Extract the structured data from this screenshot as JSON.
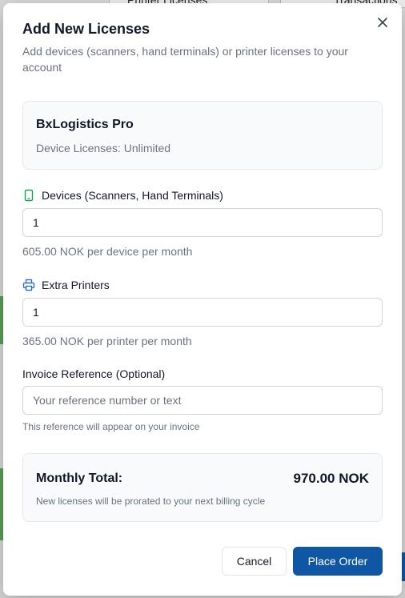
{
  "background": {
    "tab_left_label": "Printer Licenses",
    "tab_right_label": "Transactions"
  },
  "dialog": {
    "title": "Add New Licenses",
    "subtitle": "Add devices (scanners, hand terminals) or printer licenses to your account",
    "close_icon": "close-icon"
  },
  "plan": {
    "name": "BxLogistics Pro",
    "detail": "Device Licenses: Unlimited"
  },
  "devices": {
    "icon": "device-icon",
    "label": "Devices (Scanners, Hand Terminals)",
    "value": "1",
    "price_note": "605.00 NOK per device per month"
  },
  "printers": {
    "icon": "printer-icon",
    "label": "Extra Printers",
    "value": "1",
    "price_note": "365.00 NOK per printer per month"
  },
  "invoice_reference": {
    "label": "Invoice Reference (Optional)",
    "value": "",
    "placeholder": "Your reference number or text",
    "note": "This reference will appear on your invoice"
  },
  "total": {
    "label": "Monthly Total:",
    "value": "970.00 NOK",
    "note": "New licenses will be prorated to your next billing cycle"
  },
  "actions": {
    "cancel_label": "Cancel",
    "submit_label": "Place Order"
  },
  "colors": {
    "primary": "#0f57a5",
    "device_icon": "#16a34a",
    "printer_icon": "#2563eb"
  }
}
